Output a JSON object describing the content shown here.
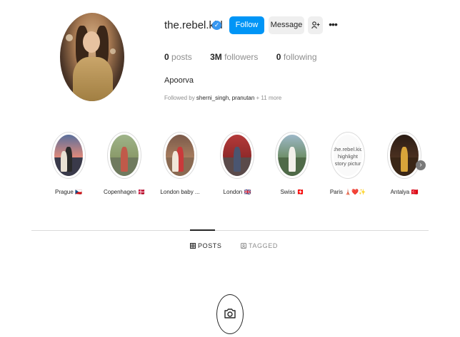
{
  "profile": {
    "username": "the.rebel.kid",
    "verified_glyph": "✓",
    "follow_label": "Follow",
    "message_label": "Message",
    "more_glyph": "•••",
    "full_name": "Apoorva",
    "posts_count": "0",
    "posts_label": "posts",
    "followers_count": "3M",
    "followers_label": "followers",
    "following_count": "0",
    "following_label": "following",
    "followed_by_prefix": "Followed by ",
    "followed_by_names": "sherni_singh, pranutan",
    "followed_by_suffix": " + 11 more"
  },
  "highlights": [
    {
      "label": "Prague 🇨🇿",
      "icon": "prague-photo"
    },
    {
      "label": "Copenhagen 🇩🇰",
      "icon": "copenhagen-photo"
    },
    {
      "label": "London baby ...",
      "icon": "london-baby-photo"
    },
    {
      "label": "London 🇬🇧",
      "icon": "london-photo"
    },
    {
      "label": "Swiss 🇨🇭",
      "icon": "swiss-photo"
    },
    {
      "label": "Paris 🗼❤️✨",
      "icon": "paris-text-cover",
      "cover_text": [
        "the.rebel.kid",
        "highlight",
        "story pictur"
      ]
    },
    {
      "label": "Antalya 🇹🇷",
      "icon": "antalya-photo"
    }
  ],
  "next_glyph": "›",
  "tabs": {
    "posts": "POSTS",
    "tagged": "TAGGED"
  },
  "colors": {
    "accent": "#0095f6",
    "verified": "#3897f0",
    "text": "#262626",
    "muted": "#8e8e8e",
    "border": "#dbdbdb",
    "button_bg": "#efefef"
  }
}
